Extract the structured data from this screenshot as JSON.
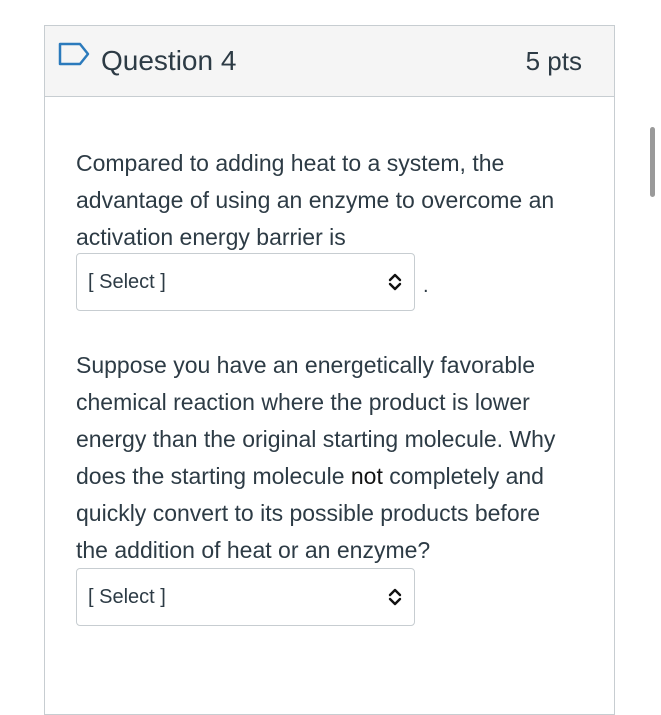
{
  "question": {
    "title": "Question 4",
    "points": "5 pts"
  },
  "prompt1": {
    "line1": "Compared to adding heat to a system, the",
    "line2": "advantage of using an enzyme to overcome an",
    "line3": "activation energy barrier is"
  },
  "select1": {
    "value": "[ Select ]",
    "suffix": "."
  },
  "prompt2": {
    "line1": "Suppose you have an energetically favorable",
    "line2": "chemical reaction where the product is lower",
    "line3": "energy than the original starting molecule. Why",
    "line4_pre": "does the starting molecule ",
    "line4_bold": "not",
    "line4_post": " completely and",
    "line5": "quickly convert to its possible products before",
    "line6": "the addition of heat or an enzyme?"
  },
  "select2": {
    "value": "[ Select ]"
  },
  "icons": {
    "flag": "flag-icon",
    "select_arrows": "chevron-up-down-icon"
  },
  "colors": {
    "text": "#2d3b45",
    "border": "#c7cdd1",
    "header_bg": "#f5f5f5",
    "flag": "#2b7abc"
  }
}
